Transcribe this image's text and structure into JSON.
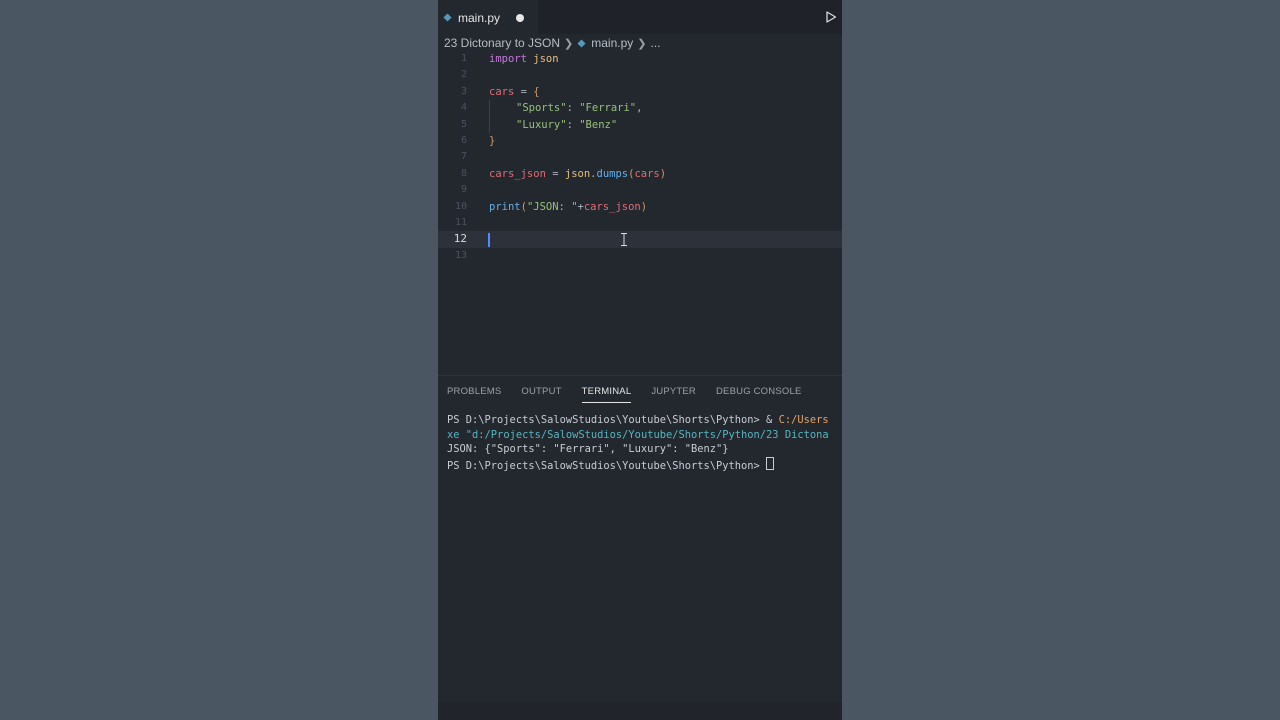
{
  "tab": {
    "filename": "main.py",
    "modified_indicator": "●"
  },
  "breadcrumb": {
    "folder": "23 Dictonary to JSON",
    "file": "main.py",
    "more": "..."
  },
  "editor": {
    "current_line": 12,
    "line_numbers": [
      "1",
      "2",
      "3",
      "4",
      "5",
      "6",
      "7",
      "8",
      "9",
      "10",
      "11",
      "12",
      "13"
    ],
    "code": {
      "l1": {
        "import": "import",
        "module": "json"
      },
      "l3": {
        "var": "cars",
        "op": " = ",
        "brace": "{"
      },
      "l4": {
        "key": "\"Sports\"",
        "colon": ": ",
        "val": "\"Ferrari\"",
        "comma": ","
      },
      "l5": {
        "key": "\"Luxury\"",
        "colon": ": ",
        "val": "\"Benz\""
      },
      "l6": {
        "brace": "}"
      },
      "l8": {
        "var": "cars_json",
        "op": " = ",
        "obj": "json",
        "dot": ".",
        "fn": "dumps",
        "open": "(",
        "arg": "cars",
        "close": ")"
      },
      "l10": {
        "fn": "print",
        "open": "(",
        "str": "\"JSON: \"",
        "plus": "+",
        "arg": "cars_json",
        "close": ")"
      }
    }
  },
  "panel": {
    "tabs": [
      "PROBLEMS",
      "OUTPUT",
      "TERMINAL",
      "JUPYTER",
      "DEBUG CONSOLE"
    ],
    "active_tab": "TERMINAL"
  },
  "terminal": {
    "line1_prompt": "PS D:\\Projects\\SalowStudios\\Youtube\\Shorts\\Python> & ",
    "line1_cmd": "C:/Users",
    "line2_prefix": "xe ",
    "line2_path": "\"d:/Projects/SalowStudios/Youtube/Shorts/Python/23 Dictona",
    "line3": "JSON: {\"Sports\": \"Ferrari\", \"Luxury\": \"Benz\"}",
    "line4_prompt": "PS D:\\Projects\\SalowStudios\\Youtube\\Shorts\\Python> "
  },
  "colors": {
    "page_bg": "#4a5661",
    "editor_bg": "#23272e",
    "keyword": "#c678dd",
    "variable": "#e06c75",
    "string": "#98c379",
    "function": "#61afef",
    "module": "#e5c07b",
    "cursor": "#528bff"
  },
  "icons": {
    "file": "python-file-icon",
    "run": "play-icon"
  }
}
